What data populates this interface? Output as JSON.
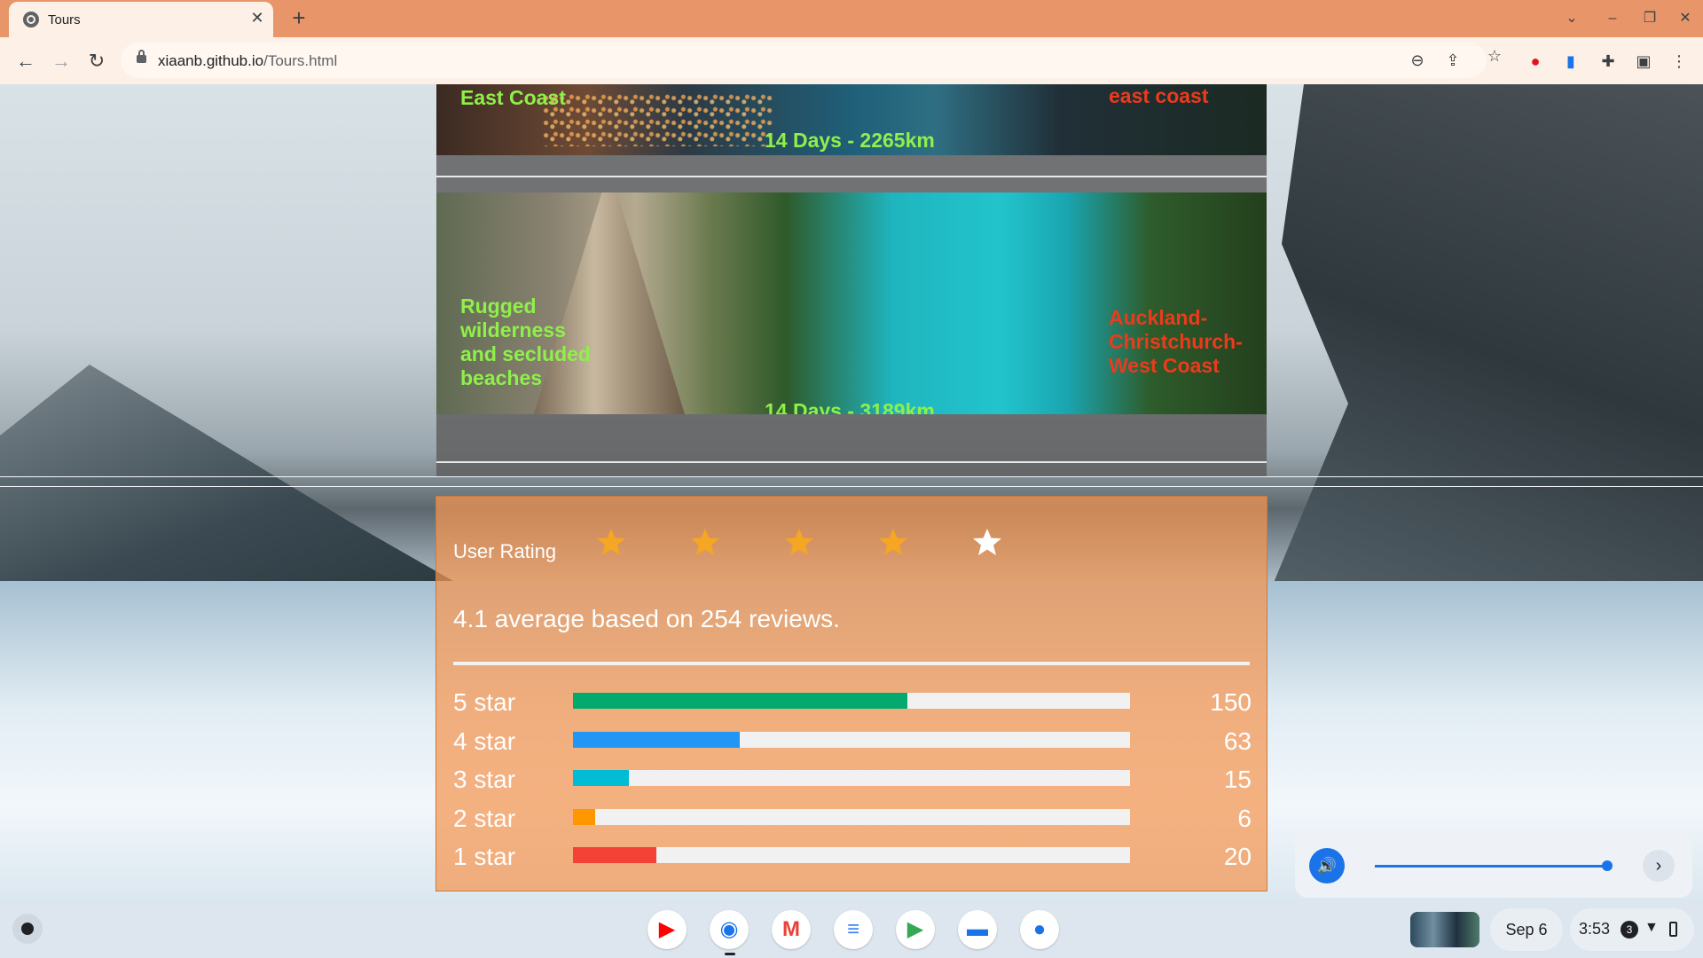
{
  "browser": {
    "tab_title": "Tours",
    "tab_close": "✕",
    "new_tab": "+",
    "url_domain": "xiaanb.github.io",
    "url_path": "/Tours.html",
    "window_controls": [
      "⌄",
      "–",
      "❐",
      "✕"
    ],
    "nav_icons": {
      "back": "←",
      "forward": "→",
      "reload": "↻"
    },
    "omni_icons": [
      "zoom-icon",
      "share-icon",
      "bookmark-star-icon"
    ],
    "extension_icons": [
      "opera-icon",
      "trello-icon",
      "puzzle-extensions-icon",
      "side-panel-icon",
      "menu-kebab-icon"
    ]
  },
  "tours": [
    {
      "tagline": "East Coast",
      "duration": "14 Days - 2265km",
      "route": "east coast"
    },
    {
      "tagline": "Rugged wilderness and secluded beaches",
      "duration": "14 Days - 3189km",
      "route": "Auckland-Christchurch-West Coast"
    }
  ],
  "rating": {
    "heading": "User Rating",
    "stars_filled": 4,
    "stars_total": 5,
    "star_color": "#f5a623",
    "summary": "4.1 average based on 254 reviews.",
    "breakdown": [
      {
        "label": "5 star",
        "count": "150",
        "fraction": 0.6,
        "color": "#04aa6d"
      },
      {
        "label": "4 star",
        "count": "63",
        "fraction": 0.3,
        "color": "#2196f3"
      },
      {
        "label": "3 star",
        "count": "15",
        "fraction": 0.1,
        "color": "#00bcd4"
      },
      {
        "label": "2 star",
        "count": "6",
        "fraction": 0.04,
        "color": "#ff9800"
      },
      {
        "label": "1 star",
        "count": "20",
        "fraction": 0.15,
        "color": "#f44336"
      }
    ]
  },
  "volume": {
    "level": 0.95,
    "accent": "#1a73e8"
  },
  "taskbar": {
    "apps": [
      "youtube-icon",
      "chrome-icon",
      "gmail-icon",
      "docs-icon",
      "play-store-icon",
      "files-icon",
      "messages-icon"
    ],
    "date": "Sep 6",
    "time": "3:53",
    "notification_count": "3"
  }
}
